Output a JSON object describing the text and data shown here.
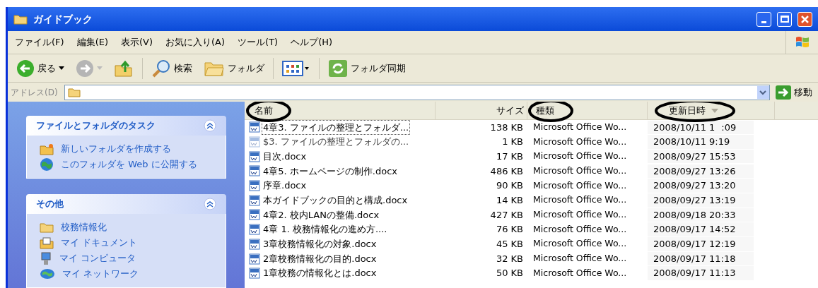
{
  "window": {
    "title": "ガイドブック"
  },
  "menu": [
    "ファイル(F)",
    "編集(E)",
    "表示(V)",
    "お気に入り(A)",
    "ツール(T)",
    "ヘルプ(H)"
  ],
  "toolbar": [
    {
      "kind": "back",
      "label": "戻る"
    },
    {
      "kind": "forward"
    },
    {
      "kind": "up"
    },
    {
      "kind": "search",
      "label": "検索"
    },
    {
      "kind": "folders",
      "label": "フォルダ"
    },
    {
      "kind": "views"
    },
    {
      "kind": "sync",
      "label": "フォルダ同期"
    }
  ],
  "address": {
    "label": "アドレス(D)",
    "go": "移動"
  },
  "panels": [
    {
      "title": "ファイルとフォルダのタスク",
      "expanded": true,
      "items": [
        {
          "kind": "new-folder",
          "label": "新しいフォルダを作成する"
        },
        {
          "kind": "globe",
          "label": "このフォルダを Web に公開する"
        }
      ]
    },
    {
      "title": "その他",
      "expanded": true,
      "items": [
        {
          "kind": "folder",
          "label": "校務情報化"
        },
        {
          "kind": "documents",
          "label": "マイ ドキュメント"
        },
        {
          "kind": "computer",
          "label": "マイ コンピュータ"
        },
        {
          "kind": "network",
          "label": "マイ ネットワーク"
        }
      ]
    }
  ],
  "table": {
    "columns": [
      "名前",
      "サイズ",
      "種類",
      "更新日時"
    ],
    "rows": [
      {
        "name": [
          "4章3. ファイルの整理とフォルダ..."
        ],
        "size": "138 KB",
        "type": "Microsoft Office Wo...",
        "modified": [
          "2008/10/11 1",
          ":09"
        ],
        "selected": true,
        "hidden": false
      },
      {
        "name": [
          "$3. ファイルの整理とフォルダの..."
        ],
        "size": "1 KB",
        "type": "Microsoft Office Wo...",
        "modified": [
          "2008/10/11 9:19"
        ],
        "selected": false,
        "hidden": true
      },
      {
        "name": [
          "目次.docx"
        ],
        "size": "17 KB",
        "type": "Microsoft Office Wo...",
        "modified": [
          "2008/09/27 15:53"
        ],
        "selected": false,
        "hidden": false
      },
      {
        "name": [
          "4章5. ホームページの制作.docx"
        ],
        "size": "486 KB",
        "type": "Microsoft Office Wo...",
        "modified": [
          "2008/09/27 13:26"
        ],
        "selected": false,
        "hidden": false
      },
      {
        "name": [
          "序章.docx"
        ],
        "size": "90 KB",
        "type": "Microsoft Office Wo...",
        "modified": [
          "2008/09/27 13:20"
        ],
        "selected": false,
        "hidden": false
      },
      {
        "name": [
          "本ガイドブックの目的と構成.docx"
        ],
        "size": "14 KB",
        "type": "Microsoft Office Wo...",
        "modified": [
          "2008/09/27 13:19"
        ],
        "selected": false,
        "hidden": false
      },
      {
        "name": [
          "4章2. 校内LANの整備.docx"
        ],
        "size": "427 KB",
        "type": "Microsoft Office Wo...",
        "modified": [
          "2008/09/18 20:33"
        ],
        "selected": false,
        "hidden": false
      },
      {
        "name": [
          "4章 1. 校務情報化の進め方...."
        ],
        "size": "76 KB",
        "type": "Microsoft Office Wo...",
        "modified": [
          "2008/09/17 14:52"
        ],
        "selected": false,
        "hidden": false
      },
      {
        "name": [
          "3章校務情報化の対象.docx"
        ],
        "size": "45 KB",
        "type": "Microsoft Office Wo...",
        "modified": [
          "2008/09/17 12:19"
        ],
        "selected": false,
        "hidden": false
      },
      {
        "name": [
          "2章校務情報化の目的.docx"
        ],
        "size": "32 KB",
        "type": "Microsoft Office Wo...",
        "modified": [
          "2008/09/17 11:18"
        ],
        "selected": false,
        "hidden": false
      },
      {
        "name": [
          "1章校務の情報化とは.docx"
        ],
        "size": "50 KB",
        "type": "Microsoft Office Wo...",
        "modified": [
          "2008/09/17 11:13"
        ],
        "selected": false,
        "hidden": false
      }
    ]
  }
}
